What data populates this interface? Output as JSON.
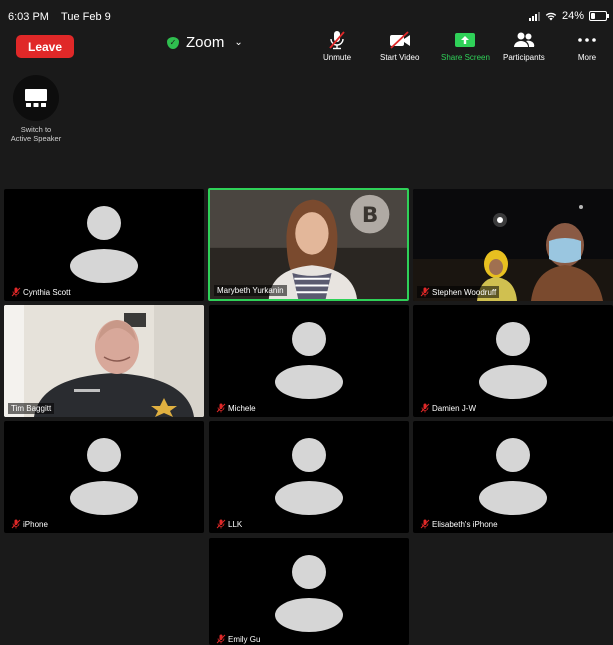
{
  "status_bar": {
    "time": "6:03 PM",
    "date": "Tue Feb 9",
    "battery": "24%"
  },
  "toolbar": {
    "leave_label": "Leave",
    "meeting_title": "Zoom",
    "unmute_label": "Unmute",
    "start_video_label": "Start Video",
    "share_screen_label": "Share Screen",
    "participants_label": "Participants",
    "more_label": "More"
  },
  "switch_view": {
    "label_line1": "Switch to",
    "label_line2": "Active Speaker"
  },
  "colors": {
    "leave": "#e02828",
    "share_screen": "#2fd158",
    "active_speaker_border": "#2fd158",
    "muted": "#e02828"
  },
  "participants": [
    {
      "name": "Cynthia Scott",
      "muted": true,
      "video": false
    },
    {
      "name": "Marybeth Yurkanin",
      "muted": false,
      "video": true,
      "active": true
    },
    {
      "name": "Stephen Woodruff",
      "muted": true,
      "video": true
    },
    {
      "name": "Tim Baggitt",
      "muted": false,
      "video": true
    },
    {
      "name": "Michele",
      "muted": true,
      "video": false
    },
    {
      "name": "Damien J-W",
      "muted": true,
      "video": false
    },
    {
      "name": "iPhone",
      "muted": true,
      "video": false
    },
    {
      "name": "LLK",
      "muted": true,
      "video": false
    },
    {
      "name": "Elisabeth's iPhone",
      "muted": true,
      "video": false
    },
    {
      "name": "Emily Gu",
      "muted": true,
      "video": false
    }
  ]
}
